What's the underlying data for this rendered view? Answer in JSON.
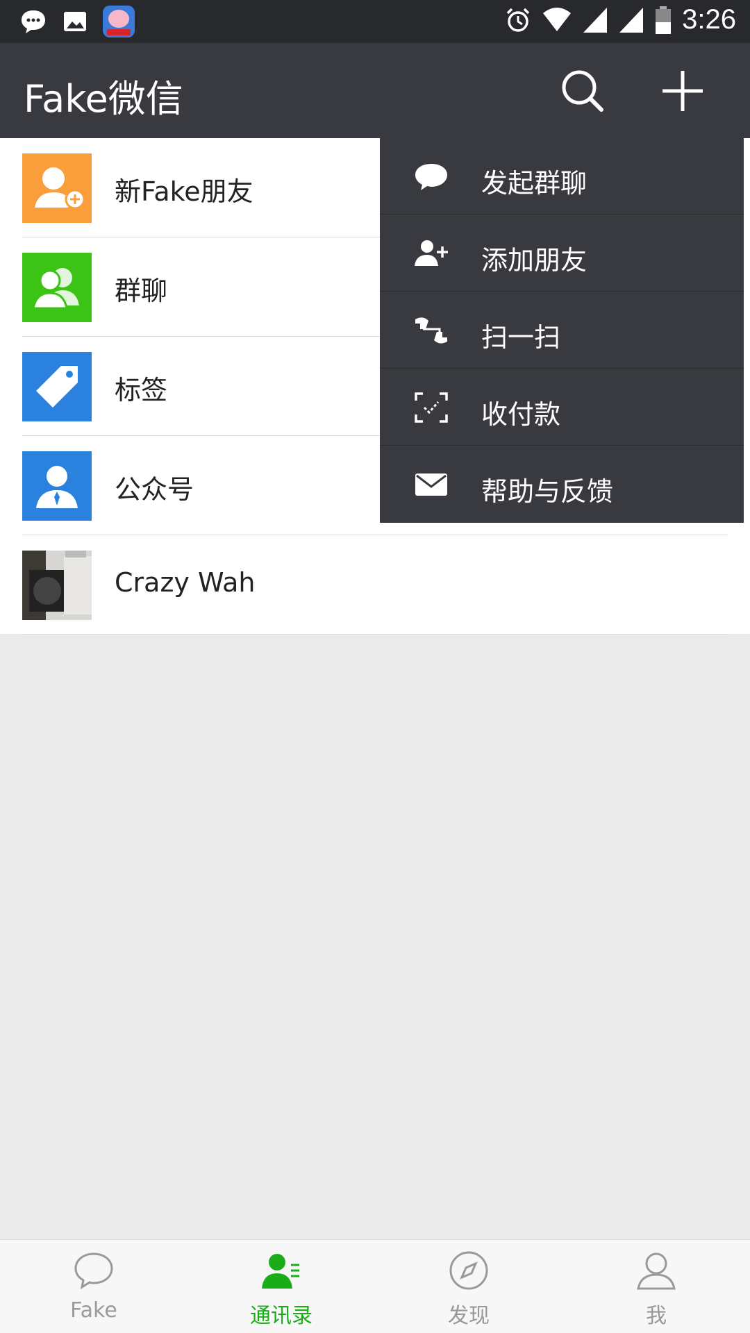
{
  "status_bar": {
    "time": "3:26",
    "icons": [
      "message-icon",
      "image-icon",
      "app-icon",
      "alarm-icon",
      "wifi-icon",
      "signal-icon",
      "signal-icon",
      "battery-icon"
    ]
  },
  "toolbar": {
    "title": "Fake微信",
    "search_icon": "search-icon",
    "plus_icon": "plus-icon"
  },
  "contacts": [
    {
      "label": "新Fake朋友",
      "icon": "add-friend-icon",
      "color": "#fa9d3b"
    },
    {
      "label": "群聊",
      "icon": "group-icon",
      "color": "#3bc316"
    },
    {
      "label": "标签",
      "icon": "tag-icon",
      "color": "#2b82de"
    },
    {
      "label": "公众号",
      "icon": "official-account-icon",
      "color": "#2b82de"
    },
    {
      "label": "Crazy Wah",
      "icon": "photo-avatar",
      "color": "#777777"
    }
  ],
  "popup_menu": [
    {
      "label": "发起群聊",
      "icon": "chat-bubble-icon"
    },
    {
      "label": "添加朋友",
      "icon": "add-person-icon"
    },
    {
      "label": "扫一扫",
      "icon": "scan-icon"
    },
    {
      "label": "收付款",
      "icon": "payment-scan-icon"
    },
    {
      "label": "帮助与反馈",
      "icon": "mail-icon"
    }
  ],
  "bottom_nav": [
    {
      "label": "Fake",
      "icon": "chat-icon",
      "active": false
    },
    {
      "label": "通讯录",
      "icon": "contacts-icon",
      "active": true
    },
    {
      "label": "发现",
      "icon": "compass-icon",
      "active": false
    },
    {
      "label": "我",
      "icon": "me-icon",
      "active": false
    }
  ],
  "colors": {
    "toolbar": "#393a3f",
    "status_bar": "#27292d",
    "accent": "#1aad19",
    "background": "#ebebeb"
  }
}
